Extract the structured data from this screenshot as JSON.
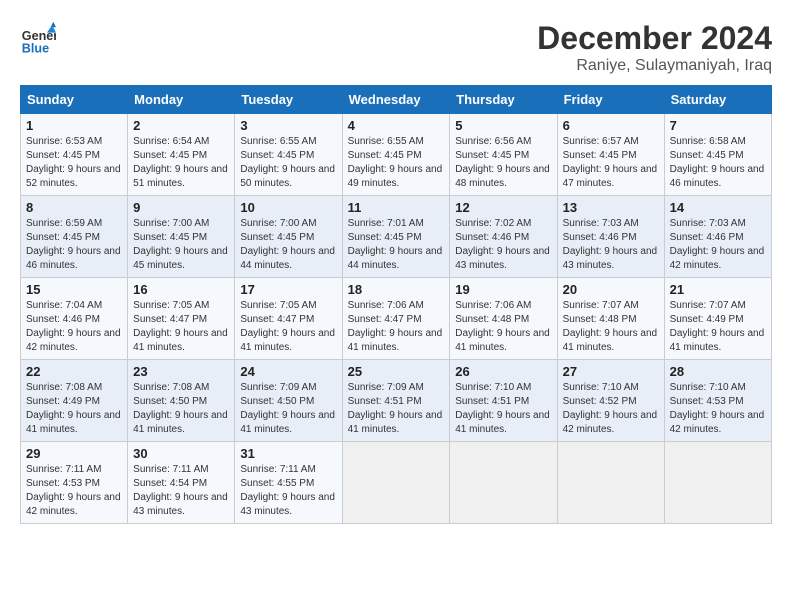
{
  "header": {
    "logo_line1": "General",
    "logo_line2": "Blue",
    "month": "December 2024",
    "location": "Raniye, Sulaymaniyah, Iraq"
  },
  "columns": [
    "Sunday",
    "Monday",
    "Tuesday",
    "Wednesday",
    "Thursday",
    "Friday",
    "Saturday"
  ],
  "weeks": [
    [
      {
        "day": "1",
        "sunrise": "6:53 AM",
        "sunset": "4:45 PM",
        "daylight": "9 hours and 52 minutes."
      },
      {
        "day": "2",
        "sunrise": "6:54 AM",
        "sunset": "4:45 PM",
        "daylight": "9 hours and 51 minutes."
      },
      {
        "day": "3",
        "sunrise": "6:55 AM",
        "sunset": "4:45 PM",
        "daylight": "9 hours and 50 minutes."
      },
      {
        "day": "4",
        "sunrise": "6:55 AM",
        "sunset": "4:45 PM",
        "daylight": "9 hours and 49 minutes."
      },
      {
        "day": "5",
        "sunrise": "6:56 AM",
        "sunset": "4:45 PM",
        "daylight": "9 hours and 48 minutes."
      },
      {
        "day": "6",
        "sunrise": "6:57 AM",
        "sunset": "4:45 PM",
        "daylight": "9 hours and 47 minutes."
      },
      {
        "day": "7",
        "sunrise": "6:58 AM",
        "sunset": "4:45 PM",
        "daylight": "9 hours and 46 minutes."
      }
    ],
    [
      {
        "day": "8",
        "sunrise": "6:59 AM",
        "sunset": "4:45 PM",
        "daylight": "9 hours and 46 minutes."
      },
      {
        "day": "9",
        "sunrise": "7:00 AM",
        "sunset": "4:45 PM",
        "daylight": "9 hours and 45 minutes."
      },
      {
        "day": "10",
        "sunrise": "7:00 AM",
        "sunset": "4:45 PM",
        "daylight": "9 hours and 44 minutes."
      },
      {
        "day": "11",
        "sunrise": "7:01 AM",
        "sunset": "4:45 PM",
        "daylight": "9 hours and 44 minutes."
      },
      {
        "day": "12",
        "sunrise": "7:02 AM",
        "sunset": "4:46 PM",
        "daylight": "9 hours and 43 minutes."
      },
      {
        "day": "13",
        "sunrise": "7:03 AM",
        "sunset": "4:46 PM",
        "daylight": "9 hours and 43 minutes."
      },
      {
        "day": "14",
        "sunrise": "7:03 AM",
        "sunset": "4:46 PM",
        "daylight": "9 hours and 42 minutes."
      }
    ],
    [
      {
        "day": "15",
        "sunrise": "7:04 AM",
        "sunset": "4:46 PM",
        "daylight": "9 hours and 42 minutes."
      },
      {
        "day": "16",
        "sunrise": "7:05 AM",
        "sunset": "4:47 PM",
        "daylight": "9 hours and 41 minutes."
      },
      {
        "day": "17",
        "sunrise": "7:05 AM",
        "sunset": "4:47 PM",
        "daylight": "9 hours and 41 minutes."
      },
      {
        "day": "18",
        "sunrise": "7:06 AM",
        "sunset": "4:47 PM",
        "daylight": "9 hours and 41 minutes."
      },
      {
        "day": "19",
        "sunrise": "7:06 AM",
        "sunset": "4:48 PM",
        "daylight": "9 hours and 41 minutes."
      },
      {
        "day": "20",
        "sunrise": "7:07 AM",
        "sunset": "4:48 PM",
        "daylight": "9 hours and 41 minutes."
      },
      {
        "day": "21",
        "sunrise": "7:07 AM",
        "sunset": "4:49 PM",
        "daylight": "9 hours and 41 minutes."
      }
    ],
    [
      {
        "day": "22",
        "sunrise": "7:08 AM",
        "sunset": "4:49 PM",
        "daylight": "9 hours and 41 minutes."
      },
      {
        "day": "23",
        "sunrise": "7:08 AM",
        "sunset": "4:50 PM",
        "daylight": "9 hours and 41 minutes."
      },
      {
        "day": "24",
        "sunrise": "7:09 AM",
        "sunset": "4:50 PM",
        "daylight": "9 hours and 41 minutes."
      },
      {
        "day": "25",
        "sunrise": "7:09 AM",
        "sunset": "4:51 PM",
        "daylight": "9 hours and 41 minutes."
      },
      {
        "day": "26",
        "sunrise": "7:10 AM",
        "sunset": "4:51 PM",
        "daylight": "9 hours and 41 minutes."
      },
      {
        "day": "27",
        "sunrise": "7:10 AM",
        "sunset": "4:52 PM",
        "daylight": "9 hours and 42 minutes."
      },
      {
        "day": "28",
        "sunrise": "7:10 AM",
        "sunset": "4:53 PM",
        "daylight": "9 hours and 42 minutes."
      }
    ],
    [
      {
        "day": "29",
        "sunrise": "7:11 AM",
        "sunset": "4:53 PM",
        "daylight": "9 hours and 42 minutes."
      },
      {
        "day": "30",
        "sunrise": "7:11 AM",
        "sunset": "4:54 PM",
        "daylight": "9 hours and 43 minutes."
      },
      {
        "day": "31",
        "sunrise": "7:11 AM",
        "sunset": "4:55 PM",
        "daylight": "9 hours and 43 minutes."
      },
      null,
      null,
      null,
      null
    ]
  ]
}
